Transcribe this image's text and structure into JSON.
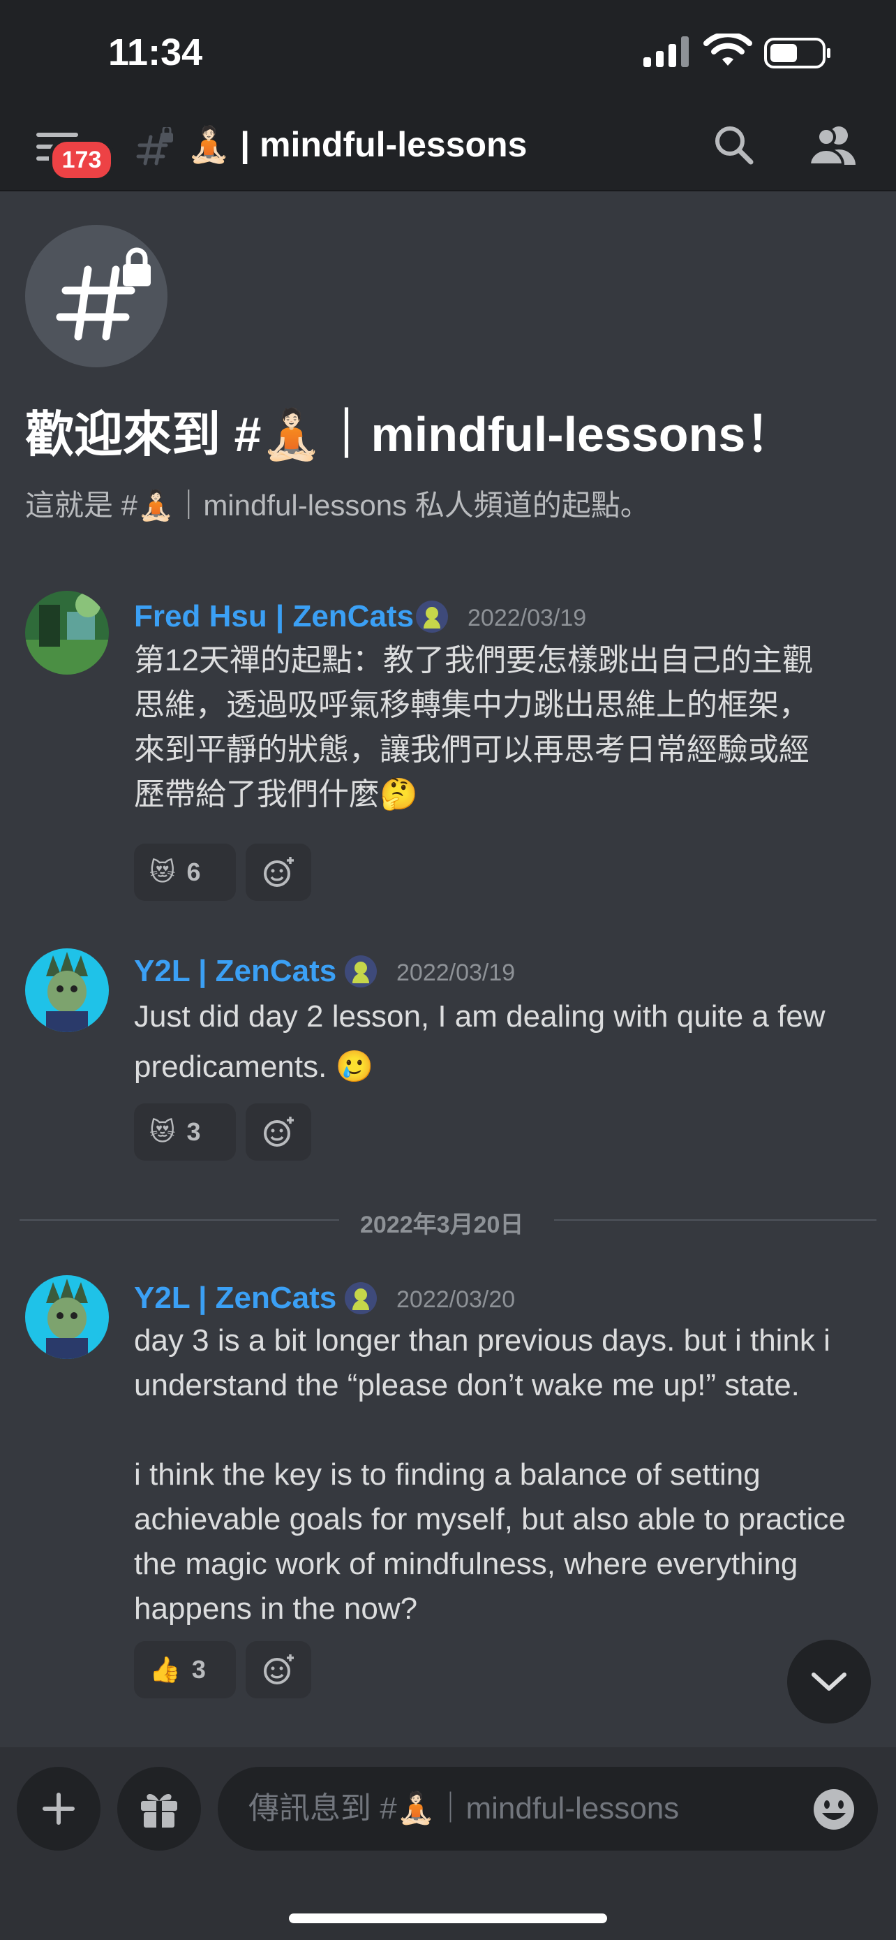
{
  "status_bar": {
    "time": "11:34"
  },
  "header": {
    "badge_count": "173",
    "channel_title": "🧘🏻 | mindful-lessons"
  },
  "welcome": {
    "title": "歡迎來到 #🧘🏻｜mindful-lessons！",
    "subtitle": "這就是 #🧘🏻｜mindful-lessons 私人頻道的起點。"
  },
  "messages": [
    {
      "author": "Fred Hsu | ZenCats",
      "timestamp": "2022/03/19",
      "lines": [
        "第12天禪的起點：教了我們要怎樣跳出自己的主觀",
        "思維，透過吸呼氣移轉集中力跳出思維上的框架，",
        "來到平靜的狀態，讓我們可以再思考日常經驗或經",
        "歷帶給了我們什麼🤔"
      ],
      "reaction": {
        "emoji": "😻",
        "count": "6"
      }
    },
    {
      "author": "Y2L | ZenCats",
      "timestamp": "2022/03/19",
      "lines": [
        "Just did day 2 lesson,  I am dealing with quite a few",
        "predicaments.  🥲"
      ],
      "reaction": {
        "emoji": "😻",
        "count": "3"
      }
    },
    {
      "author": "Y2L | ZenCats",
      "timestamp": "2022/03/20",
      "lines": [
        "day 3 is a bit longer than previous days. but i think i",
        "understand the “please don’t wake me up!” state.",
        "",
        "i think the key is to finding a balance of setting",
        "achievable goals for myself, but also able to practice",
        "the magic work of mindfulness, where everything",
        "happens in the now?"
      ],
      "reaction": {
        "emoji": "👍",
        "count": "3"
      }
    }
  ],
  "date_divider": "2022年3月20日",
  "composer": {
    "placeholder": "傳訊息到 #🧘🏻｜mindful-lessons"
  },
  "colors": {
    "background": "#36393f",
    "header": "#202225",
    "author": "#3ba0f5",
    "badge": "#ed4245"
  }
}
